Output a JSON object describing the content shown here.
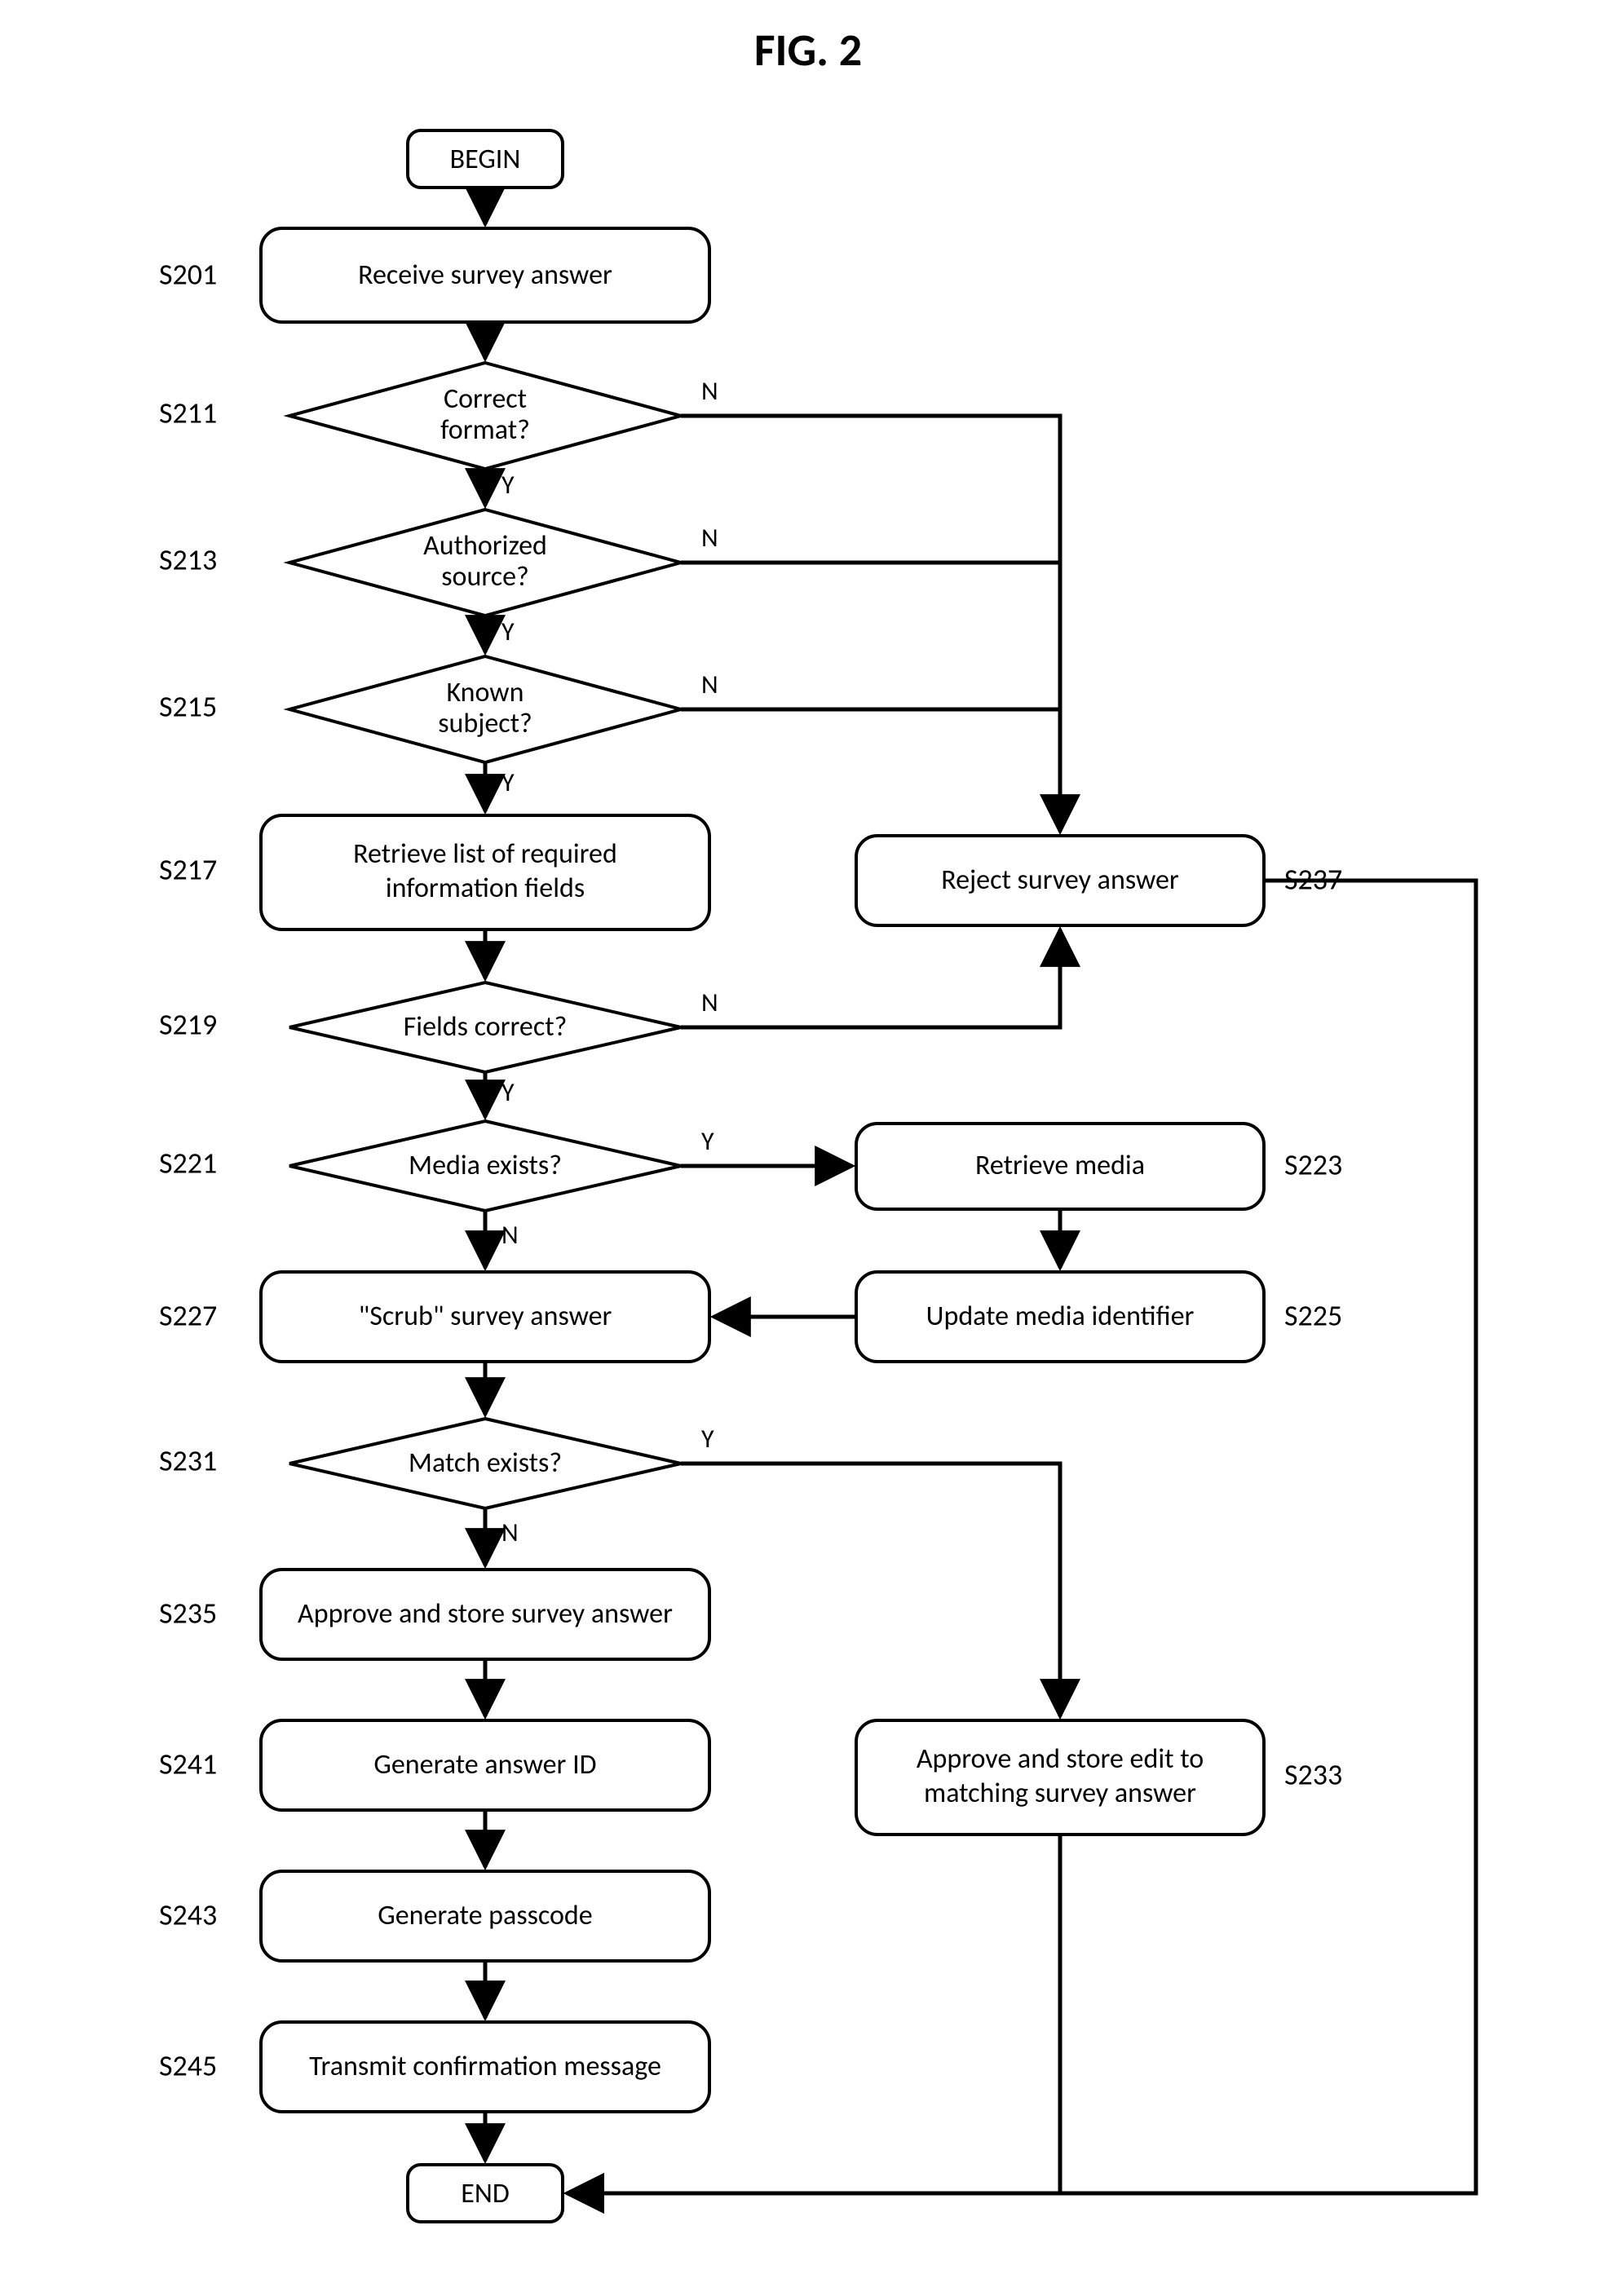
{
  "chart_data": {
    "type": "flowchart",
    "title": "FIG. 2",
    "nodes": [
      {
        "id": "begin",
        "kind": "terminator",
        "label": "BEGIN"
      },
      {
        "id": "s201",
        "kind": "process",
        "code": "S201",
        "label": "Receive survey answer"
      },
      {
        "id": "s211",
        "kind": "decision",
        "code": "S211",
        "label": "Correct format?"
      },
      {
        "id": "s213",
        "kind": "decision",
        "code": "S213",
        "label": "Authorized source?"
      },
      {
        "id": "s215",
        "kind": "decision",
        "code": "S215",
        "label": "Known subject?"
      },
      {
        "id": "s217",
        "kind": "process",
        "code": "S217",
        "label": "Retrieve list of required information fields"
      },
      {
        "id": "s219",
        "kind": "decision",
        "code": "S219",
        "label": "Fields correct?"
      },
      {
        "id": "s221",
        "kind": "decision",
        "code": "S221",
        "label": "Media exists?"
      },
      {
        "id": "s223",
        "kind": "process",
        "code": "S223",
        "label": "Retrieve media"
      },
      {
        "id": "s225",
        "kind": "process",
        "code": "S225",
        "label": "Update media identifier"
      },
      {
        "id": "s227",
        "kind": "process",
        "code": "S227",
        "label": "\"Scrub\" survey answer"
      },
      {
        "id": "s231",
        "kind": "decision",
        "code": "S231",
        "label": "Match exists?"
      },
      {
        "id": "s233",
        "kind": "process",
        "code": "S233",
        "label": "Approve and store edit to matching survey answer"
      },
      {
        "id": "s235",
        "kind": "process",
        "code": "S235",
        "label": "Approve and store survey answer"
      },
      {
        "id": "s237",
        "kind": "process",
        "code": "S237",
        "label": "Reject survey answer"
      },
      {
        "id": "s241",
        "kind": "process",
        "code": "S241",
        "label": "Generate answer ID"
      },
      {
        "id": "s243",
        "kind": "process",
        "code": "S243",
        "label": "Generate  passcode"
      },
      {
        "id": "s245",
        "kind": "process",
        "code": "S245",
        "label": "Transmit confirmation message"
      },
      {
        "id": "end",
        "kind": "terminator",
        "label": "END"
      }
    ],
    "edges": [
      {
        "from": "begin",
        "to": "s201"
      },
      {
        "from": "s201",
        "to": "s211"
      },
      {
        "from": "s211",
        "to": "s213",
        "label": "Y"
      },
      {
        "from": "s211",
        "to": "s237",
        "label": "N"
      },
      {
        "from": "s213",
        "to": "s215",
        "label": "Y"
      },
      {
        "from": "s213",
        "to": "s237",
        "label": "N"
      },
      {
        "from": "s215",
        "to": "s217",
        "label": "Y"
      },
      {
        "from": "s215",
        "to": "s237",
        "label": "N"
      },
      {
        "from": "s217",
        "to": "s219"
      },
      {
        "from": "s219",
        "to": "s221",
        "label": "Y"
      },
      {
        "from": "s219",
        "to": "s237",
        "label": "N"
      },
      {
        "from": "s221",
        "to": "s227",
        "label": "N"
      },
      {
        "from": "s221",
        "to": "s223",
        "label": "Y"
      },
      {
        "from": "s223",
        "to": "s225"
      },
      {
        "from": "s225",
        "to": "s227"
      },
      {
        "from": "s227",
        "to": "s231"
      },
      {
        "from": "s231",
        "to": "s235",
        "label": "N"
      },
      {
        "from": "s231",
        "to": "s233",
        "label": "Y"
      },
      {
        "from": "s235",
        "to": "s241"
      },
      {
        "from": "s241",
        "to": "s243"
      },
      {
        "from": "s243",
        "to": "s245"
      },
      {
        "from": "s245",
        "to": "end"
      },
      {
        "from": "s233",
        "to": "end"
      },
      {
        "from": "s237",
        "to": "end"
      }
    ]
  },
  "title": "FIG. 2",
  "begin": "BEGIN",
  "end": "END",
  "s201_code": "S201",
  "s201_label": "Receive survey answer",
  "s211_code": "S211",
  "s211_l1": "Correct",
  "s211_l2": "format?",
  "s213_code": "S213",
  "s213_l1": "Authorized",
  "s213_l2": "source?",
  "s215_code": "S215",
  "s215_l1": "Known",
  "s215_l2": "subject?",
  "s217_code": "S217",
  "s217_l1": "Retrieve list of required",
  "s217_l2": "information fields",
  "s219_code": "S219",
  "s219_label": "Fields correct?",
  "s221_code": "S221",
  "s221_label": "Media exists?",
  "s223_code": "S223",
  "s223_label": "Retrieve media",
  "s225_code": "S225",
  "s225_label": "Update media identifier",
  "s227_code": "S227",
  "s227_label": "\"Scrub\" survey answer",
  "s231_code": "S231",
  "s231_label": "Match exists?",
  "s233_code": "S233",
  "s233_l1": "Approve and store edit to",
  "s233_l2": "matching survey answer",
  "s235_code": "S235",
  "s235_label": "Approve and store survey answer",
  "s237_code": "S237",
  "s237_label": "Reject survey answer",
  "s241_code": "S241",
  "s241_label": "Generate answer ID",
  "s243_code": "S243",
  "s243_label": "Generate  passcode",
  "s245_code": "S245",
  "s245_label": "Transmit confirmation message",
  "Y": "Y",
  "N": "N"
}
